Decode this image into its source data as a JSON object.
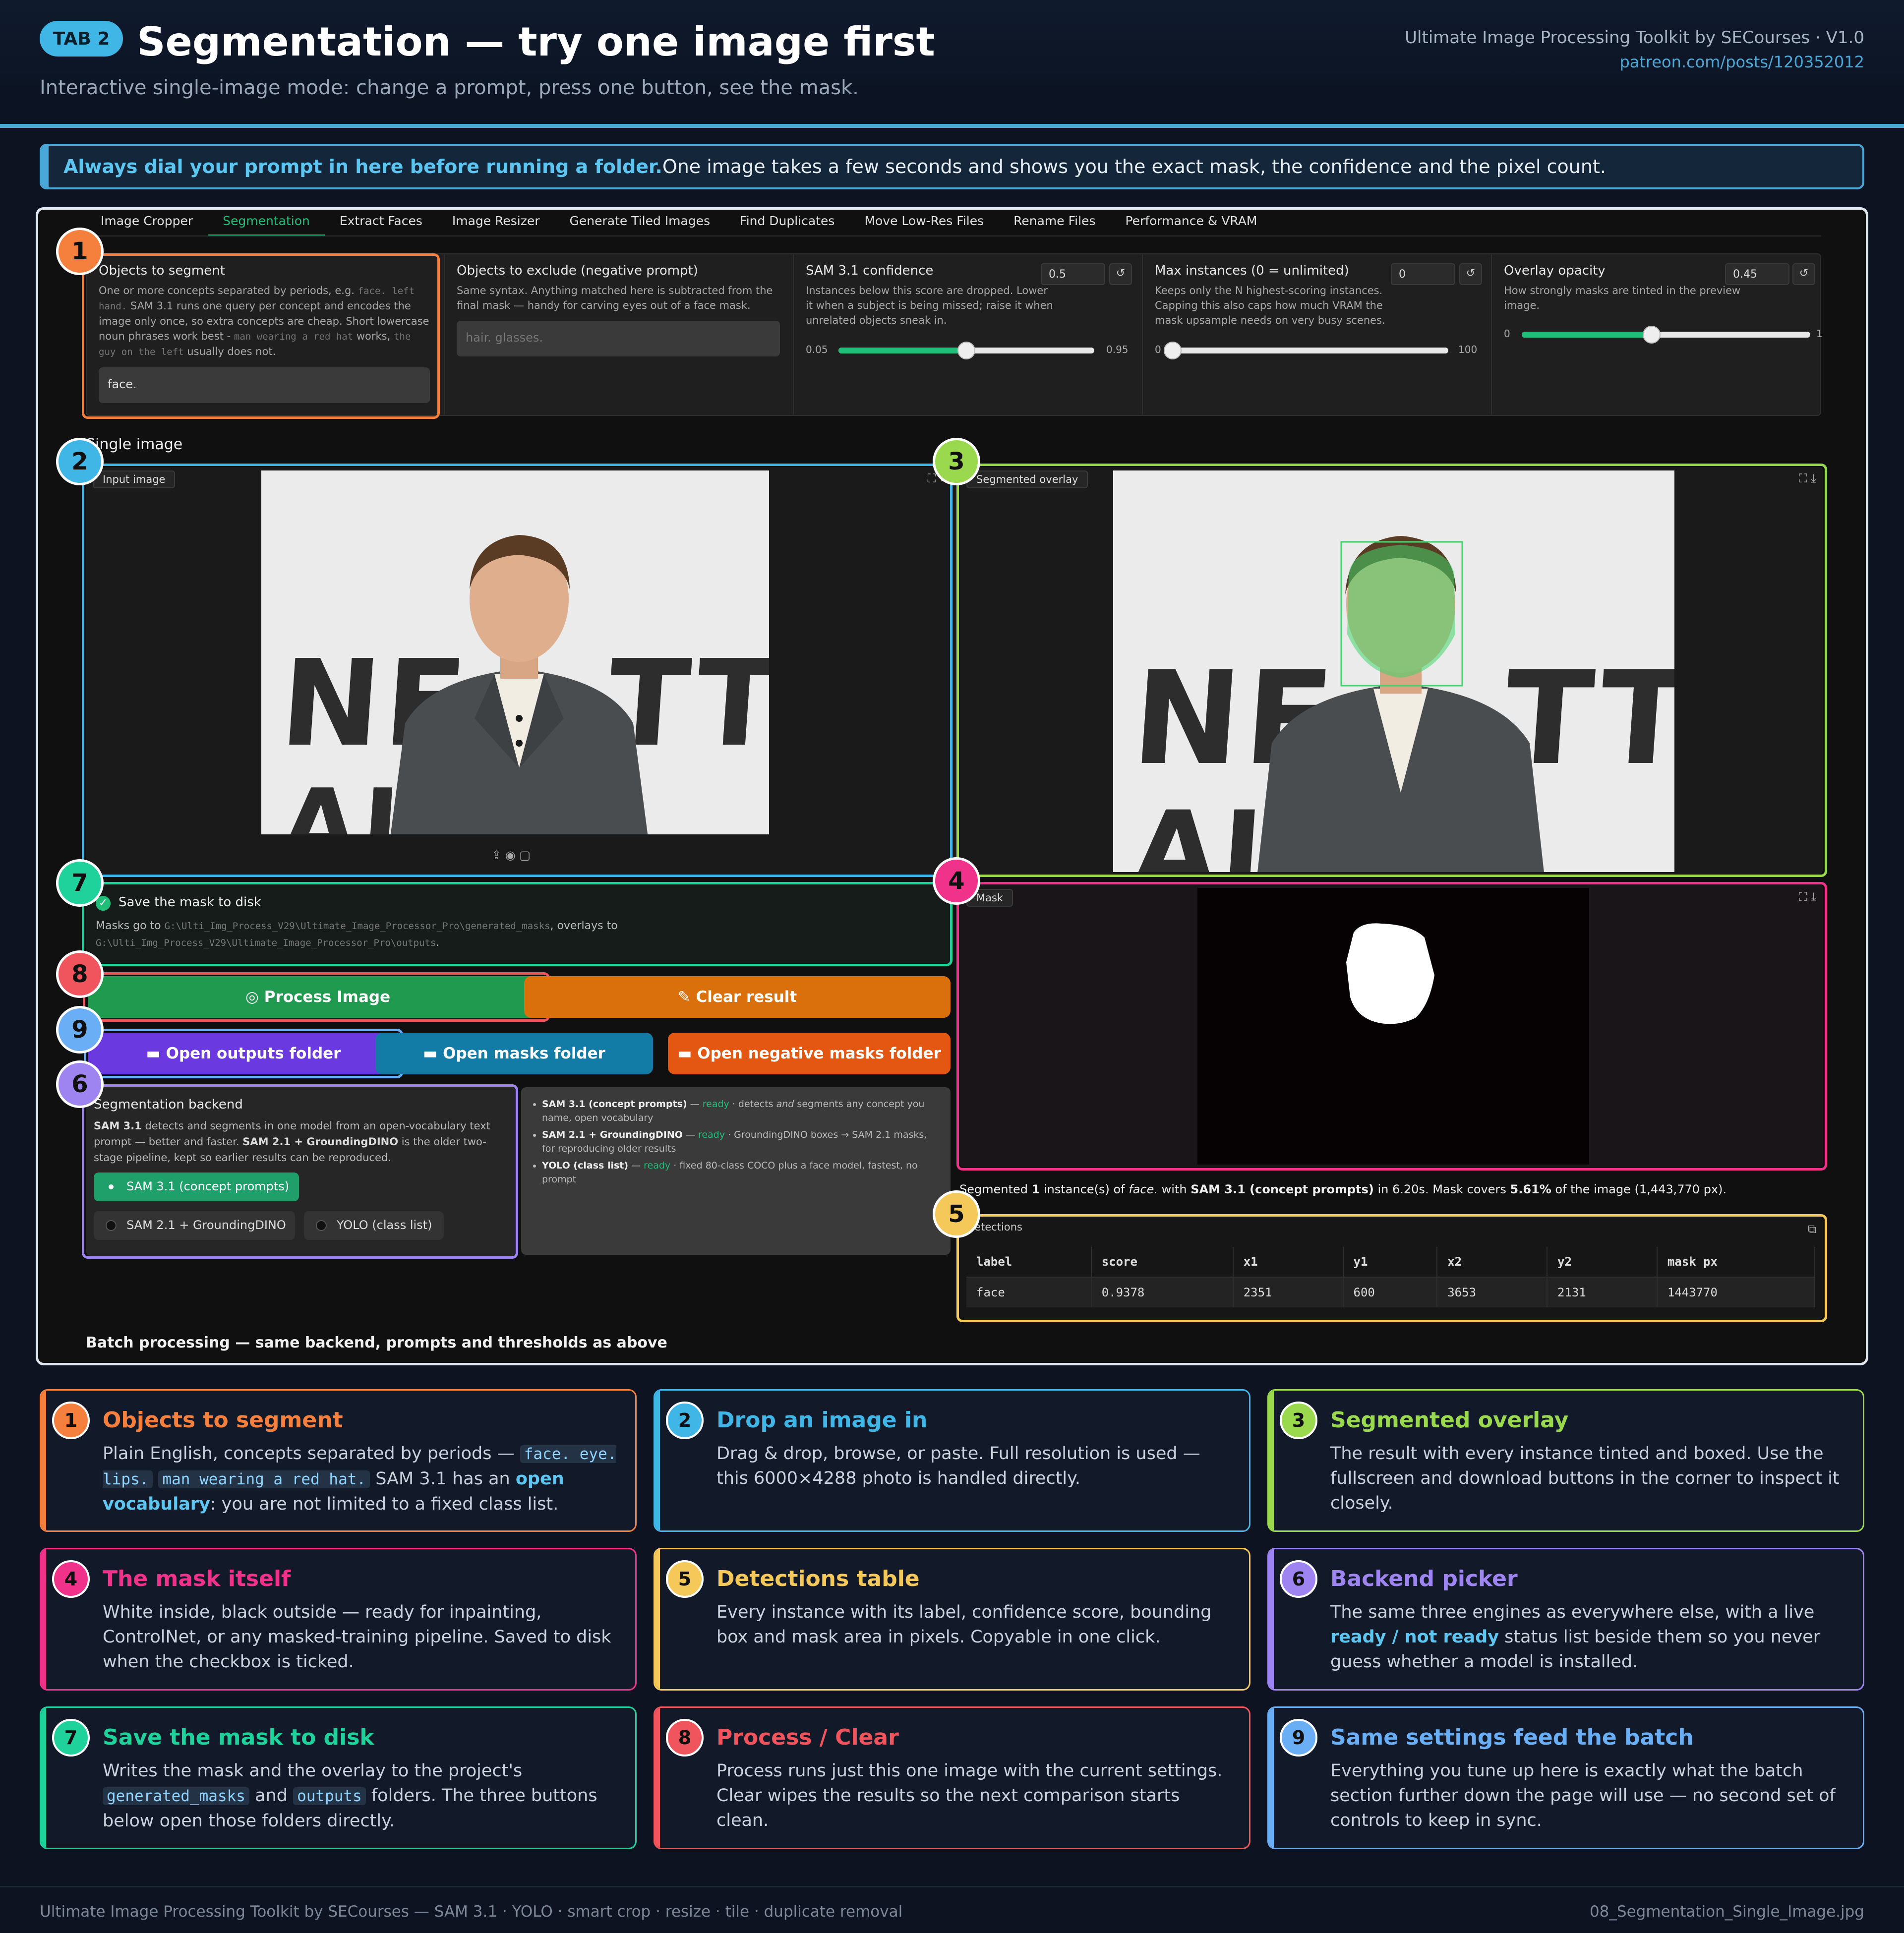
{
  "header": {
    "tab_badge": "TAB 2",
    "title": "Segmentation — try one image first",
    "subtitle": "Interactive single-image mode: change a prompt, press one button, see the mask.",
    "brand": "Ultimate Image Processing Toolkit by SECourses · V1.0",
    "brand_url": "patreon.com/posts/120352012"
  },
  "callout": {
    "bold": "Always dial your prompt in here before running a folder.",
    "rest": " One image takes a few seconds and shows you the exact mask, the confidence and the pixel count."
  },
  "app": {
    "tabs": [
      "Image Cropper",
      "Segmentation",
      "Extract Faces",
      "Image Resizer",
      "Generate Tiled Images",
      "Find Duplicates",
      "Move Low-Res Files",
      "Rename Files",
      "Performance & VRAM"
    ],
    "objects": {
      "label": "Objects to segment",
      "desc_a": "One or more concepts separated by periods, e.g. ",
      "desc_code1": "face. left hand.",
      "desc_b": " SAM 3.1 runs one query per concept and encodes the image only once, so extra concepts are cheap. Short lowercase noun phrases work best - ",
      "desc_code2": "man wearing a red hat",
      "desc_c": " works, ",
      "desc_code3": "the guy on the left",
      "desc_d": " usually does not.",
      "value": "face."
    },
    "exclude": {
      "label": "Objects to exclude (negative prompt)",
      "desc": "Same syntax. Anything matched here is subtracted from the final mask — handy for carving eyes out of a face mask.",
      "placeholder": "hair. glasses."
    },
    "confidence": {
      "label": "SAM 3.1 confidence",
      "value": "0.5",
      "desc": "Instances below this score are dropped. Lower it when a subject is being missed; raise it when unrelated objects sneak in.",
      "min": "0.05",
      "max": "0.95",
      "fraction": 0.5
    },
    "max_instances": {
      "label": "Max instances (0 = unlimited)",
      "value": "0",
      "desc": "Keeps only the N highest-scoring instances. Capping this also caps how much VRAM the mask upsample needs on very busy scenes.",
      "min": "0",
      "max": "100",
      "fraction": 0.0
    },
    "overlay": {
      "label": "Overlay opacity",
      "value": "0.45",
      "desc": "How strongly masks are tinted in the preview image.",
      "min": "0",
      "max": "1",
      "fraction": 0.45
    },
    "reset_icon": "reset-icon",
    "single_image_label": "Single image",
    "input_image_label": "Input image",
    "overlay_image_label": "Segmented overlay",
    "mask_label": "Mask",
    "poster_text_1": "NE",
    "poster_text_2": "TTI",
    "poster_text_3": "AI",
    "save": {
      "label": "Save the mask to disk",
      "desc_a": "Masks go to ",
      "path1": "G:\\Ulti_Img_Process_V29\\Ultimate_Image_Processor_Pro\\generated_masks",
      "desc_b": ", overlays to ",
      "path2": "G:\\Ulti_Img_Process_V29\\Ultimate_Image_Processor_Pro\\outputs",
      "desc_c": "."
    },
    "buttons": {
      "process": "Process Image",
      "clear": "Clear result",
      "open_outputs": "Open outputs folder",
      "open_masks": "Open masks folder",
      "open_negative": "Open negative masks folder"
    },
    "backend": {
      "label": "Segmentation backend",
      "desc_a": "SAM 3.1",
      "desc_b": " detects and segments in one model from an open-vocabulary text prompt — better and faster. ",
      "desc_c": "SAM 2.1 + GroundingDINO",
      "desc_d": " is the older two-stage pipeline, kept so earlier results can be reproduced.",
      "options": [
        "SAM 3.1 (concept prompts)",
        "SAM 2.1 + GroundingDINO",
        "YOLO (class list)"
      ],
      "status": [
        {
          "name": "SAM 3.1 (concept prompts)",
          "state": "ready",
          "a": " · detects ",
          "em": "and",
          "b": " segments any concept you name, open vocabulary"
        },
        {
          "name": "SAM 2.1 + GroundingDINO",
          "state": "ready",
          "a": " · GroundingDINO boxes → SAM 2.1 masks, for reproducing older results",
          "em": "",
          "b": ""
        },
        {
          "name": "YOLO (class list)",
          "state": "ready",
          "a": " · fixed 80-class COCO plus a face model, fastest, no prompt",
          "em": "",
          "b": ""
        }
      ]
    },
    "result": {
      "a": "Segmented ",
      "count": "1",
      "b": " instance(s) of ",
      "concept": "face.",
      "c": " with ",
      "model": "SAM 3.1 (concept prompts)",
      "d": " in 6.20s. Mask covers ",
      "pct": "5.61%",
      "e": " of the image (1,443,770 px)."
    },
    "detections": {
      "label": "Detections",
      "columns": [
        "label",
        "score",
        "x1",
        "y1",
        "x2",
        "y2",
        "mask px"
      ],
      "rows": [
        [
          "face",
          "0.9378",
          "2351",
          "600",
          "3653",
          "2131",
          "1443770"
        ]
      ]
    },
    "batch_label": "Batch processing — same backend, prompts and thresholds as above"
  },
  "cards": [
    {
      "n": "1",
      "title": "Objects to segment",
      "color": "#f5803e"
    },
    {
      "n": "2",
      "title": "Drop an image in",
      "color": "#3fb6e6"
    },
    {
      "n": "3",
      "title": "Segmented overlay",
      "color": "#9ad84e"
    },
    {
      "n": "4",
      "title": "The mask itself",
      "color": "#f0328a"
    },
    {
      "n": "5",
      "title": "Detections table",
      "color": "#f5c85a"
    },
    {
      "n": "6",
      "title": "Backend picker",
      "color": "#9d84f0"
    },
    {
      "n": "7",
      "title": "Save the mask to disk",
      "color": "#1fd19a"
    },
    {
      "n": "8",
      "title": "Process / Clear",
      "color": "#f0545c"
    },
    {
      "n": "9",
      "title": "Same settings feed the batch",
      "color": "#6aaef5"
    }
  ],
  "card_text": {
    "c1_a": "Plain English, concepts separated by periods — ",
    "c1_code1": "face. eye. lips.",
    "c1_code2": "man wearing a red hat.",
    "c1_b": " SAM 3.1 has an ",
    "c1_hl": "open vocabulary",
    "c1_c": ": you are not limited to a fixed class list.",
    "c2": "Drag & drop, browse, or paste. Full resolution is used — this 6000×4288 photo is handled directly.",
    "c3": "The result with every instance tinted and boxed. Use the fullscreen and download buttons in the corner to inspect it closely.",
    "c4": "White inside, black outside — ready for inpainting, ControlNet, or any masked-training pipeline. Saved to disk when the checkbox is ticked.",
    "c5": "Every instance with its label, confidence score, bounding box and mask area in pixels. Copyable in one click.",
    "c6_a": "The same three engines as everywhere else, with a live ",
    "c6_hl1": "ready",
    "c6_b": " / ",
    "c6_hl2": "not ready",
    "c6_c": " status list beside them so you never guess whether a model is installed.",
    "c7_a": "Writes the mask and the overlay to the project's ",
    "c7_code1": "generated_masks",
    "c7_b": " and ",
    "c7_code2": "outputs",
    "c7_c": " folders. The three buttons below open those folders directly.",
    "c8": "Process runs just this one image with the current settings. Clear wipes the results so the next comparison starts clean.",
    "c9": "Everything you tune up here is exactly what the batch section further down the page will use — no second set of controls to keep in sync."
  },
  "footer": {
    "left": "Ultimate Image Processing Toolkit by SECourses — SAM 3.1 · YOLO · smart crop · resize · tile · duplicate removal",
    "right": "08_Segmentation_Single_Image.jpg"
  }
}
